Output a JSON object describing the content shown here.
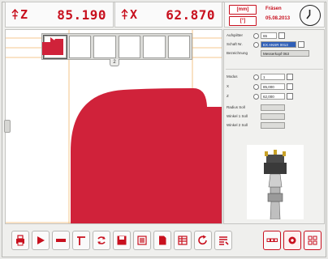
{
  "dro": {
    "z": {
      "axis": "Z",
      "value": "85.190"
    },
    "x": {
      "axis": "X",
      "value": "62.870"
    }
  },
  "info": {
    "unit_mm": "[mm]",
    "unit_deg": "[°]",
    "operation": "Fräsen",
    "date": "05.08.2013"
  },
  "canvas": {
    "expander_label": "2",
    "shapes": [
      "corner-square",
      "ramp",
      "step-slope",
      "step-down",
      "s-curve",
      "fillet-corner"
    ],
    "accent_color": "#d0223a"
  },
  "panel": {
    "rows": [
      {
        "label": "Aufspiltter",
        "value": "65"
      },
      {
        "label": "Schaft Nr.",
        "value": "EX ANSR 0013"
      },
      {
        "label": "Bezeichnung",
        "value": "Messerkopf 063"
      },
      {
        "label": "Modus",
        "value": "1"
      },
      {
        "label": "X",
        "value": "85,000"
      },
      {
        "label": "Z",
        "value": "62,000"
      },
      {
        "label": "Radius Soll",
        "value": ""
      },
      {
        "label": "Winkel 1 Soll",
        "value": ""
      },
      {
        "label": "Winkel 2 Soll",
        "value": ""
      }
    ]
  },
  "toolbar": {
    "icons": [
      "print-icon",
      "play-icon",
      "minus-icon",
      "contour-icon",
      "refresh-icon",
      "save-icon",
      "list-icon",
      "document-icon",
      "table-icon",
      "redo-icon",
      "list-edit-icon",
      "view-mode-icon",
      "settings-icon",
      "grid-icon"
    ]
  }
}
